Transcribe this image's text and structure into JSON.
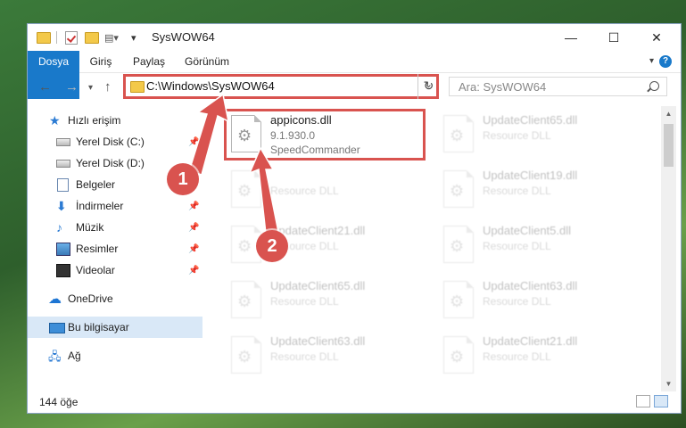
{
  "window": {
    "title": "SysWOW64",
    "controls": {
      "minimize": "—",
      "maximize": "☐",
      "close": "✕"
    }
  },
  "ribbon": {
    "tabs": [
      {
        "label": "Dosya",
        "active": true
      },
      {
        "label": "Giriş"
      },
      {
        "label": "Paylaş"
      },
      {
        "label": "Görünüm"
      }
    ],
    "help": "?"
  },
  "address": {
    "path": "C:\\Windows\\SysWOW64",
    "back": "←",
    "forward": "→",
    "up": "↑",
    "refresh": "↻"
  },
  "search": {
    "placeholder": "Ara: SysWOW64"
  },
  "sidebar": {
    "items": [
      {
        "label": "Hızlı erişim",
        "icon": "star-icon"
      },
      {
        "label": "Yerel Disk (C:)",
        "icon": "disk-icon",
        "pinned": true
      },
      {
        "label": "Yerel Disk (D:)",
        "icon": "disk-icon"
      },
      {
        "label": "Belgeler",
        "icon": "documents-icon"
      },
      {
        "label": "İndirmeler",
        "icon": "downloads-icon",
        "pinned": true
      },
      {
        "label": "Müzik",
        "icon": "music-icon",
        "pinned": true
      },
      {
        "label": "Resimler",
        "icon": "pictures-icon",
        "pinned": true
      },
      {
        "label": "Videolar",
        "icon": "videos-icon",
        "pinned": true
      },
      {
        "label": "OneDrive",
        "icon": "cloud-icon"
      },
      {
        "label": "Bu bilgisayar",
        "icon": "computer-icon",
        "selected": true
      },
      {
        "label": "Ağ",
        "icon": "network-icon"
      }
    ]
  },
  "files": [
    {
      "name": "appicons.dll",
      "version": "9.1.930.0",
      "company": "SpeedCommander",
      "highlighted": true
    },
    {
      "name": "UpdateClient65.dll",
      "desc": "Resource DLL"
    },
    {
      "name": "",
      "desc": "Resource DLL"
    },
    {
      "name": "UpdateClient19.dll",
      "desc": "Resource DLL"
    },
    {
      "name": "UpdateClient21.dll",
      "desc": "Resource DLL"
    },
    {
      "name": "UpdateClient5.dll",
      "desc": "Resource DLL"
    },
    {
      "name": "UpdateClient65.dll",
      "desc": "Resource DLL"
    },
    {
      "name": "UpdateClient63.dll",
      "desc": "Resource DLL"
    },
    {
      "name": "UpdateClient63.dll",
      "desc": "Resource DLL"
    },
    {
      "name": "UpdateClient21.dll",
      "desc": "Resource DLL"
    }
  ],
  "status": {
    "item_count": "144 öğe"
  },
  "annotations": {
    "step1": "1",
    "step2": "2",
    "accent": "#d9534f"
  }
}
